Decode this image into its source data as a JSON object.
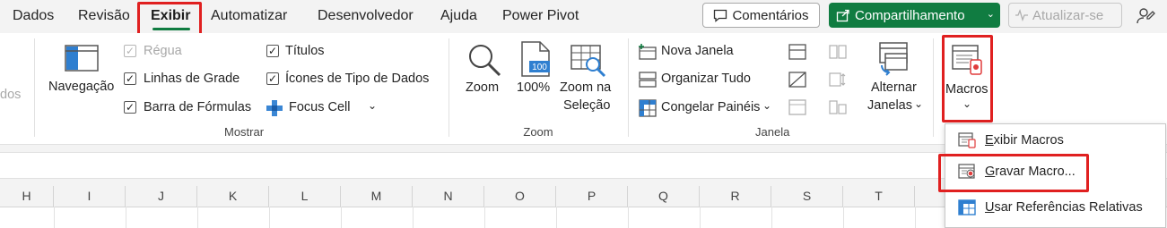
{
  "tabs": [
    {
      "label": "Dados"
    },
    {
      "label": "Revisão"
    },
    {
      "label": "Exibir"
    },
    {
      "label": "Automatizar"
    },
    {
      "label": "Desenvolvedor"
    },
    {
      "label": "Ajuda"
    },
    {
      "label": "Power Pivot"
    }
  ],
  "header_buttons": {
    "comments": "Comentários",
    "share": "Compartilhamento",
    "update": "Atualizar-se"
  },
  "ribbon": {
    "left_cut_label": "dos",
    "navigation": "Navegação",
    "show": {
      "regua": "Régua",
      "linhas_grade": "Linhas de Grade",
      "barra_formulas": "Barra de Fórmulas",
      "titulos": "Títulos",
      "icones_tipo": "Ícones de Tipo de Dados",
      "focus_cell": "Focus Cell",
      "group_label": "Mostrar"
    },
    "zoom": {
      "zoom": "Zoom",
      "pct": "100%",
      "zoom_selection_1": "Zoom na",
      "zoom_selection_2": "Seleção",
      "icon_pct": "100",
      "group_label": "Zoom"
    },
    "window": {
      "nova_janela": "Nova Janela",
      "organizar_tudo": "Organizar Tudo",
      "congelar": "Congelar Painéis",
      "alternar_1": "Alternar",
      "alternar_2": "Janelas",
      "group_label": "Janela"
    },
    "macros": {
      "label": "Macros"
    }
  },
  "columns": [
    "H",
    "I",
    "J",
    "K",
    "L",
    "M",
    "N",
    "O",
    "P",
    "Q",
    "R",
    "S",
    "T"
  ],
  "dropdown": {
    "items": [
      {
        "accel": "E",
        "rest": "xibir Macros"
      },
      {
        "accel": "G",
        "rest": "ravar Macro..."
      },
      {
        "accel": "U",
        "rest": "sar Referências Relativas"
      }
    ]
  }
}
